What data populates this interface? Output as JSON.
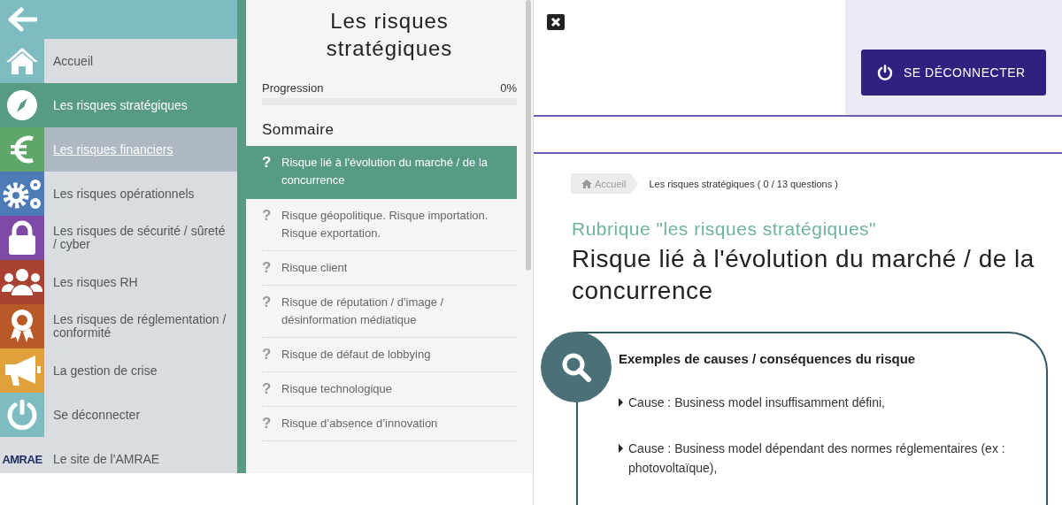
{
  "nav": {
    "items": [
      {
        "kind": "home",
        "color": "#7fbcc2",
        "label": "Accueil",
        "selected": false,
        "hovered": false
      },
      {
        "kind": "compass",
        "color": "#579c82",
        "label": "Les risques stratégiques",
        "selected": true,
        "hovered": false
      },
      {
        "kind": "euro",
        "color": "#5fa66a",
        "label": "Les risques financiers",
        "selected": false,
        "hovered": true
      },
      {
        "kind": "gears",
        "color": "#4d7bb6",
        "label": "Les risques opérationnels",
        "selected": false,
        "hovered": false
      },
      {
        "kind": "lock",
        "color": "#7e4aa6",
        "label": "Les risques de sécurité / sûreté / cyber",
        "selected": false,
        "hovered": false
      },
      {
        "kind": "people",
        "color": "#a84233",
        "label": "Les risques RH",
        "selected": false,
        "hovered": false
      },
      {
        "kind": "rosette",
        "color": "#b85a28",
        "label": "Les risques de réglementation / conformité",
        "selected": false,
        "hovered": false
      },
      {
        "kind": "megaphone",
        "color": "#e0a03c",
        "label": "La gestion de crise",
        "selected": false,
        "hovered": false
      },
      {
        "kind": "power",
        "color": "#7fbcc2",
        "label": "Se déconnecter",
        "selected": false,
        "hovered": false
      },
      {
        "kind": "logo",
        "logo_text": "AMRAE",
        "label": "Le site de l'AMRAE",
        "selected": false,
        "hovered": false
      }
    ]
  },
  "summary_panel": {
    "title": "Les risques stratégiques",
    "progress_label": "Progression",
    "progress_value": "0%",
    "level": 0,
    "section_title": "Sommaire",
    "items": [
      {
        "icon": "?",
        "label": "Risque lié à l'évolution du marché / de la concurrence",
        "selected": true
      },
      {
        "icon": "?",
        "label": "Risque géopolitique. Risque importation. Risque exportation.",
        "selected": false
      },
      {
        "icon": "?",
        "label": "Risque client",
        "selected": false
      },
      {
        "icon": "?",
        "label": "Risque de réputation / d'image / désinformation médiatique",
        "selected": false
      },
      {
        "icon": "?",
        "label": "Risque de défaut de lobbying",
        "selected": false
      },
      {
        "icon": "?",
        "label": "Risque technologique",
        "selected": false
      },
      {
        "icon": "?",
        "label": "Risque d’absence d’innovation",
        "selected": false
      }
    ]
  },
  "header": {
    "logout_button": "SE DÉCONNECTER"
  },
  "breadcrumb": {
    "home": "Accueil",
    "current": "Les risques stratégiques ( 0 / 13 questions )"
  },
  "content": {
    "rubric": "Rubrique \"les risques stratégiques\"",
    "title": "Risque lié à l'évolution du marché / de la concurrence",
    "card": {
      "heading": "Exemples de causes / conséquences du risque",
      "bullets": [
        "Cause : Business model insuffisamment défini,",
        "Cause : Business model dépendant des normes réglementaires (ex : photovoltaïque),"
      ]
    }
  }
}
